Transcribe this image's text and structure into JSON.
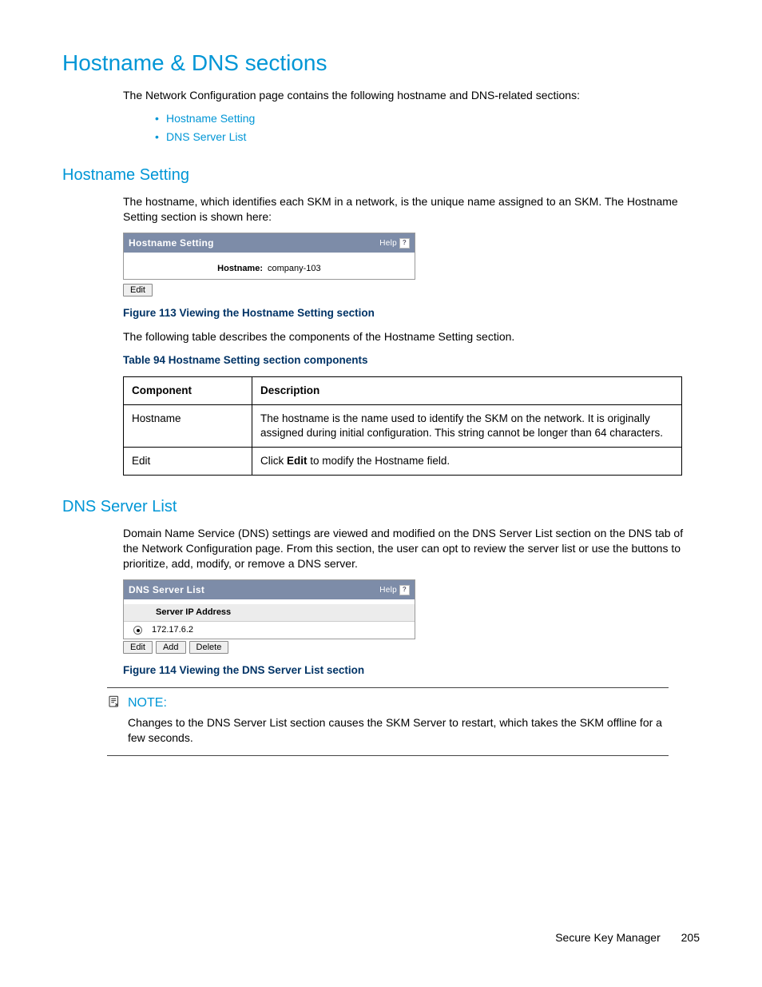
{
  "headings": {
    "main": "Hostname & DNS sections",
    "hostname_setting": "Hostname Setting",
    "dns_server_list": "DNS Server List"
  },
  "intro_para": "The Network Configuration page contains the following hostname and DNS-related sections:",
  "bullets": [
    "Hostname Setting",
    "DNS Server List"
  ],
  "hostname_section": {
    "para": "The hostname, which identifies each SKM in a network, is the unique name assigned to an SKM. The Hostname Setting section is shown here:",
    "panel_title": "Hostname Setting",
    "help_label": "Help",
    "field_label": "Hostname:",
    "field_value": "company-103",
    "edit_button": "Edit",
    "figure_caption": "Figure 113 Viewing the Hostname Setting section",
    "para2": "The following table describes the components of the Hostname Setting section.",
    "table_caption": "Table 94 Hostname Setting section components",
    "table_headers": [
      "Component",
      "Description"
    ],
    "table_rows": [
      {
        "component": "Hostname",
        "description": "The hostname is the name used to identify the SKM on the network. It is originally assigned during initial configuration. This string cannot be longer than 64 characters."
      },
      {
        "component": "Edit",
        "description_pre": "Click ",
        "description_bold": "Edit",
        "description_post": " to modify the Hostname field."
      }
    ]
  },
  "dns_section": {
    "para": "Domain Name Service (DNS) settings are viewed and modified on the DNS Server List section on the DNS tab of the Network Configuration page. From this section, the user can opt to review the server list or use the buttons to prioritize, add, modify, or remove a DNS server.",
    "panel_title": "DNS Server List",
    "help_label": "Help",
    "column_header": "Server IP Address",
    "server_ip": "172.17.6.2",
    "buttons": {
      "edit": "Edit",
      "add": "Add",
      "delete": "Delete"
    },
    "figure_caption": "Figure 114 Viewing the DNS Server List section",
    "note_label": "NOTE:",
    "note_text": "Changes to the DNS Server List section causes the SKM Server to restart, which takes the SKM offline for a few seconds."
  },
  "footer": {
    "doc_title": "Secure Key Manager",
    "page_number": "205"
  }
}
